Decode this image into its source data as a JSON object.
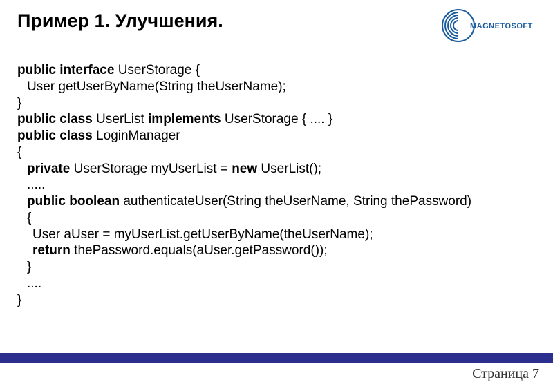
{
  "header": {
    "title": "Пример 1. Улучшения.",
    "logo_text": "MAGNETOSOFT"
  },
  "code": {
    "l1a": "public interface",
    "l1b": " UserStorage {",
    "l2": "User getUserByName(String theUserName);",
    "l3": "}",
    "l4a": "public class",
    "l4b": " UserList ",
    "l4c": "implements",
    "l4d": " UserStorage { .... }",
    "l5a": "public class",
    "l5b": " LoginManager",
    "l6": "{",
    "l7a": "private",
    "l7b": " UserStorage myUserList = ",
    "l7c": "new",
    "l7d": " UserList();",
    "l8": ".....",
    "l9a": "public boolean",
    "l9b": " authenticateUser(String theUserName, String thePassword)",
    "l10": "{",
    "l11": "User aUser = myUserList.getUserByName(theUserName);",
    "l12a": "return",
    "l12b": " thePassword.equals(aUser.getPassword());",
    "l13": "}",
    "l14": "....",
    "l15": "}"
  },
  "footer": {
    "page_label": "Страница 7"
  }
}
